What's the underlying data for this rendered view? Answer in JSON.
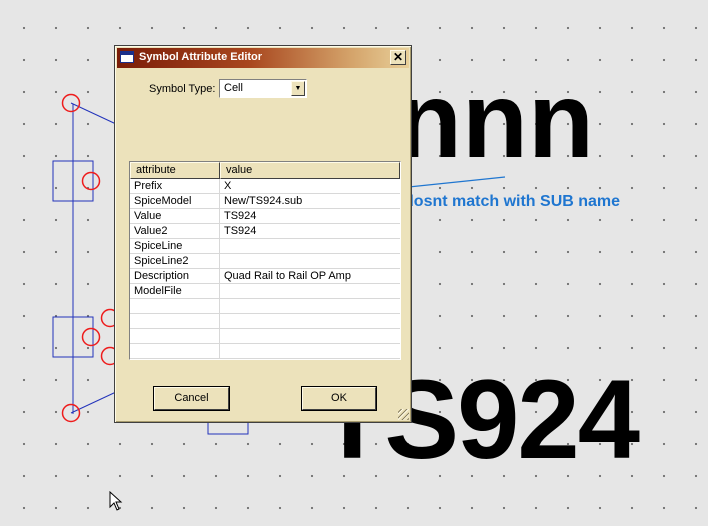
{
  "background": {
    "large_text_top": "nnn",
    "large_text_bottom": "TS924",
    "annotation": "Name dosnt match with SUB name",
    "annotation_color": "#1f76d0"
  },
  "dialog": {
    "title": "Symbol Attribute Editor",
    "close_glyph": "✕",
    "symbol_type_label": "Symbol Type:",
    "symbol_type_value": "Cell",
    "symbol_type_arrow": "▼",
    "table": {
      "headers": [
        "attribute",
        "value"
      ],
      "rows": [
        {
          "attribute": "Prefix",
          "value": "X"
        },
        {
          "attribute": "SpiceModel",
          "value": "New/TS924.sub"
        },
        {
          "attribute": "Value",
          "value": "TS924"
        },
        {
          "attribute": "Value2",
          "value": "TS924"
        },
        {
          "attribute": "SpiceLine",
          "value": ""
        },
        {
          "attribute": "SpiceLine2",
          "value": ""
        },
        {
          "attribute": "Description",
          "value": "Quad Rail to Rail OP Amp"
        },
        {
          "attribute": "ModelFile",
          "value": ""
        },
        {
          "attribute": "",
          "value": ""
        },
        {
          "attribute": "",
          "value": ""
        },
        {
          "attribute": "",
          "value": ""
        },
        {
          "attribute": "",
          "value": ""
        },
        {
          "attribute": "",
          "value": ""
        }
      ]
    },
    "cancel_label": "Cancel",
    "ok_label": "OK",
    "titlebar_color": "#7a1d08",
    "dialog_bg_color": "#ece2bb"
  }
}
